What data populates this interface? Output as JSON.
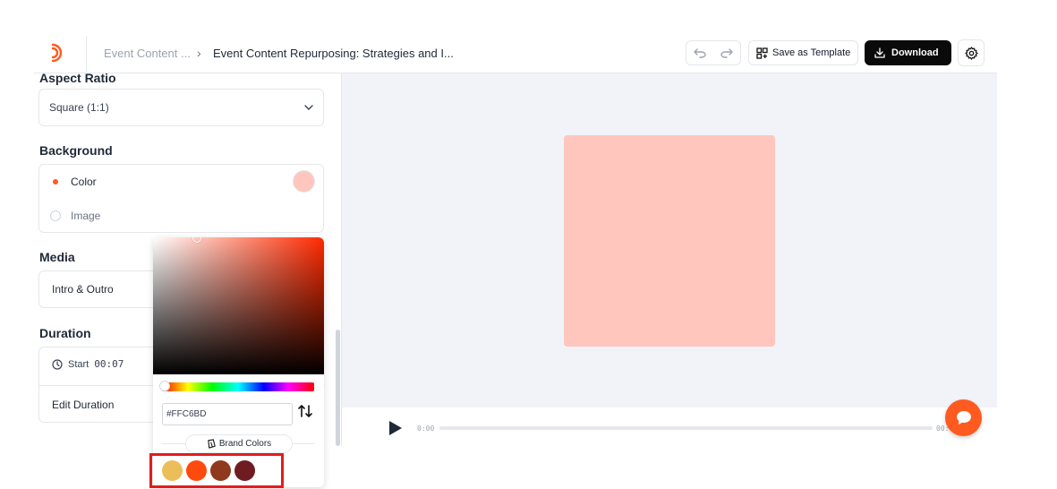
{
  "header": {
    "breadcrumb_parent": "Event Content ...",
    "breadcrumb_current": "Event Content Repurposing: Strategies and I...",
    "save_template_label": "Save as Template",
    "download_label": "Download",
    "icons": [
      "logo-icon",
      "undo-icon",
      "redo-icon",
      "template-icon",
      "download-icon",
      "gear-icon"
    ]
  },
  "sidebar": {
    "aspect_ratio": {
      "title": "Aspect Ratio",
      "value": "Square (1:1)"
    },
    "background": {
      "title": "Background",
      "options": [
        {
          "label": "Color",
          "selected": true
        },
        {
          "label": "Image",
          "selected": false
        }
      ],
      "color": "#FFC6BD"
    },
    "media": {
      "title": "Media",
      "item": "Intro & Outro"
    },
    "duration": {
      "title": "Duration",
      "start_label": "Start",
      "start_value": "00:07",
      "edit_label": "Edit Duration"
    }
  },
  "color_picker": {
    "hex_value": "#FFC6BD",
    "brand_colors_label": "Brand Colors",
    "brand_colors": [
      "#EBBE5A",
      "#FF4A0D",
      "#8F3A1E",
      "#6E1B22"
    ]
  },
  "canvas": {
    "artboard_color": "#FFC6BD"
  },
  "player": {
    "time_start": "0:00",
    "time_end": "00:"
  },
  "colors": {
    "accent": "#FF5A1F",
    "download_bg": "#0A0A0A",
    "canvas_bg": "#F1F3F8",
    "highlight": "#E11D1D"
  }
}
